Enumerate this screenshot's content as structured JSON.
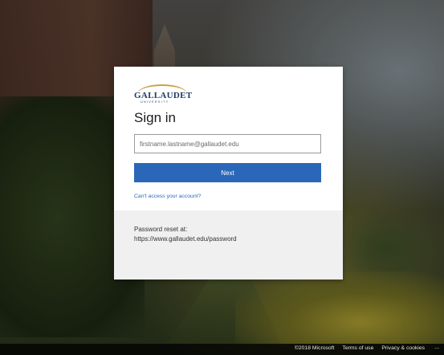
{
  "brand": {
    "name": "GALLAUDET",
    "subtitle": "UNIVERSITY"
  },
  "signin": {
    "title": "Sign in",
    "email_placeholder": "firstname.lastname@gallaudet.edu",
    "next_label": "Next",
    "cant_access_label": "Can't access your account?"
  },
  "info": {
    "line1": "Password reset at:",
    "line2": "https://www.gallaudet.edu/password"
  },
  "footer": {
    "copyright": "©2018 Microsoft",
    "terms_label": "Terms of use",
    "privacy_label": "Privacy & cookies",
    "more_label": "..."
  },
  "colors": {
    "accent": "#2a67b8",
    "brand_navy": "#1f3a6b",
    "brand_gold": "#c8a24a"
  }
}
